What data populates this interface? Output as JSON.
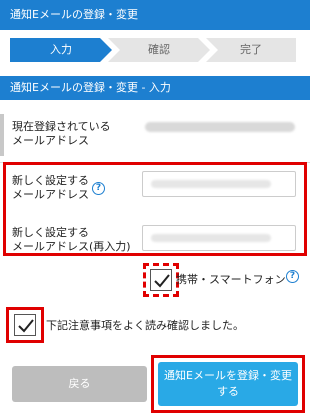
{
  "header": {
    "title": "通知Eメールの登録・変更"
  },
  "steps": [
    {
      "label": "入力"
    },
    {
      "label": "確認"
    },
    {
      "label": "完了"
    }
  ],
  "section": {
    "title": "通知Eメールの登録・変更 - 入力"
  },
  "current_email": {
    "label_line1": "現在登録されている",
    "label_line2": "メールアドレス"
  },
  "new_email": {
    "label_line1": "新しく設定する",
    "label_line2": "メールアドレス"
  },
  "new_email_confirm": {
    "label_line1": "新しく設定する",
    "label_line2": "メールアドレス(再入力)"
  },
  "mobile_option": {
    "label": "携帯・スマートフォン",
    "checked": true
  },
  "agree": {
    "label": "下記注意事項をよく読み確認しました。",
    "checked": true
  },
  "buttons": {
    "back": "戻る",
    "submit_line1": "通知Eメールを登録・変更",
    "submit_line2": "する"
  },
  "colors": {
    "primary": "#1d7fd0",
    "highlight": "#e00000",
    "submit": "#29a9e6",
    "disabled": "#bdbdbd"
  }
}
